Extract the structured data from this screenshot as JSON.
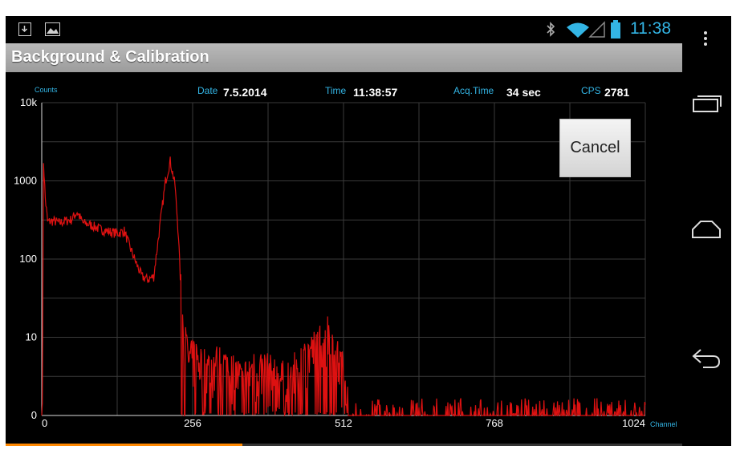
{
  "status_bar": {
    "time": "11:38",
    "left_icons": [
      "download-notification-icon",
      "image-notification-icon"
    ],
    "right_icons": [
      "bluetooth-icon",
      "wifi-icon",
      "signal-icon",
      "battery-icon"
    ]
  },
  "app": {
    "title": "Background & Calibration"
  },
  "info": {
    "date_label": "Date",
    "date_value": "7.5.2014",
    "time_label": "Time",
    "time_value": "11:38:57",
    "acq_label": "Acq.Time",
    "acq_value": "34 sec",
    "cps_label": "CPS",
    "cps_value": "2781"
  },
  "cancel_label": "Cancel",
  "nav": {
    "icons": [
      "overflow-menu-icon",
      "recent-apps-icon",
      "home-icon",
      "back-icon"
    ]
  },
  "progress": {
    "fraction": 0.35,
    "color": "#ff8800"
  },
  "colors": {
    "accent": "#33b5e5",
    "series": "#dd1111",
    "grid": "#3a3a3a"
  },
  "chart_data": {
    "type": "line",
    "x_label": "Channel",
    "y_label": "Counts",
    "xlim": [
      0,
      1024
    ],
    "ylim": [
      0,
      10000
    ],
    "y_scale": "log",
    "x_ticks": [
      "0",
      "256",
      "512",
      "768",
      "1024"
    ],
    "y_ticks": [
      "0",
      "10",
      "100",
      "1000",
      "10k"
    ],
    "grid": true,
    "series": [
      {
        "points": [
          [
            0,
            0
          ],
          [
            3,
            1800
          ],
          [
            6,
            600
          ],
          [
            10,
            300
          ],
          [
            20,
            310
          ],
          [
            30,
            290
          ],
          [
            40,
            310
          ],
          [
            50,
            320
          ],
          [
            60,
            400
          ],
          [
            70,
            290
          ],
          [
            80,
            280
          ],
          [
            90,
            260
          ],
          [
            100,
            240
          ],
          [
            110,
            230
          ],
          [
            120,
            220
          ],
          [
            130,
            215
          ],
          [
            140,
            230
          ],
          [
            150,
            140
          ],
          [
            160,
            90
          ],
          [
            170,
            60
          ],
          [
            180,
            55
          ],
          [
            190,
            60
          ],
          [
            200,
            250
          ],
          [
            210,
            1000
          ],
          [
            218,
            1800
          ],
          [
            226,
            900
          ],
          [
            232,
            200
          ],
          [
            236,
            40
          ],
          [
            240,
            12
          ],
          [
            250,
            5
          ],
          [
            260,
            6
          ],
          [
            280,
            4
          ],
          [
            300,
            5
          ],
          [
            320,
            4
          ],
          [
            340,
            3
          ],
          [
            360,
            4
          ],
          [
            380,
            4
          ],
          [
            400,
            3
          ],
          [
            420,
            3
          ],
          [
            440,
            5
          ],
          [
            450,
            6
          ],
          [
            460,
            7
          ],
          [
            470,
            9
          ],
          [
            480,
            11
          ],
          [
            485,
            12
          ],
          [
            490,
            10
          ],
          [
            500,
            6
          ],
          [
            510,
            4
          ],
          [
            520,
            2
          ],
          [
            540,
            1.5
          ],
          [
            560,
            1.2
          ],
          [
            600,
            1
          ],
          [
            650,
            1
          ],
          [
            700,
            1
          ],
          [
            750,
            1
          ],
          [
            800,
            1
          ],
          [
            850,
            0.8
          ],
          [
            900,
            0.8
          ],
          [
            950,
            0.7
          ],
          [
            1000,
            0.5
          ],
          [
            1024,
            0.4
          ]
        ]
      }
    ]
  }
}
